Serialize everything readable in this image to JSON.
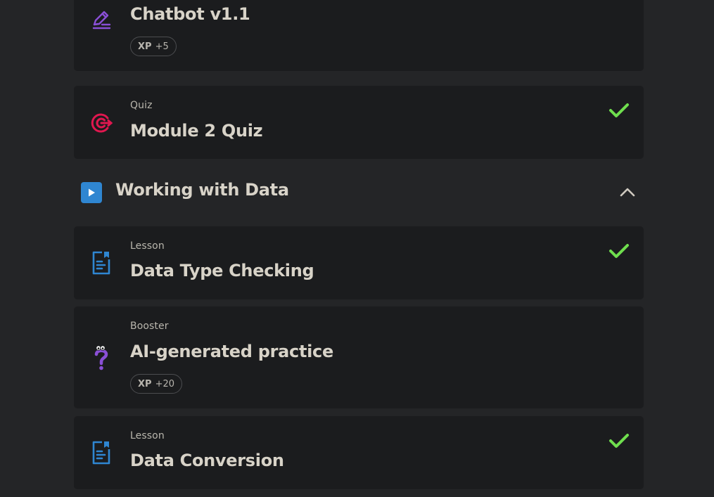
{
  "items_top": [
    {
      "id": "chatbot",
      "type_label": "",
      "title": "Chatbot v1.1",
      "icon": "pencil-icon",
      "xp_key": "XP",
      "xp_value": "+5",
      "completed": false
    },
    {
      "id": "module2quiz",
      "type_label": "Quiz",
      "title": "Module 2 Quiz",
      "icon": "target-icon",
      "completed": true
    }
  ],
  "section": {
    "title": "Working with Data",
    "icon": "play-icon",
    "expanded": true,
    "toggle_icon": "chevron-up-icon"
  },
  "items_section": [
    {
      "id": "datatypechecking",
      "type_label": "Lesson",
      "title": "Data Type Checking",
      "icon": "lesson-document-icon",
      "completed": true
    },
    {
      "id": "aipractice",
      "type_label": "Booster",
      "title": "AI-generated practice",
      "icon": "question-mark-icon",
      "xp_key": "XP",
      "xp_value": "+20",
      "completed": false
    },
    {
      "id": "dataconversion",
      "type_label": "Lesson",
      "title": "Data Conversion",
      "icon": "lesson-document-icon",
      "completed": true
    }
  ],
  "colors": {
    "background": "#242527",
    "card": "#1b1c1e",
    "check": "#6fde4e",
    "lesson_icon": "#2f86d1",
    "quiz_icon": "#e0174f",
    "chatbot_icon": "#8a4fd6",
    "booster_icon": "#8a4fd6"
  }
}
